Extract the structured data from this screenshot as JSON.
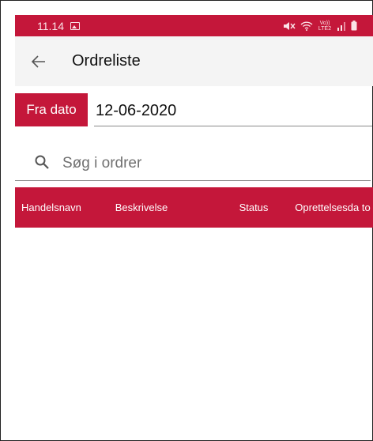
{
  "statusbar": {
    "time": "11.14",
    "icons": [
      "gallery-icon",
      "mute-icon",
      "wifi-icon",
      "volte-icon",
      "signal-icon",
      "battery-icon"
    ],
    "volte_text": "Vo)) LTE2"
  },
  "appbar": {
    "back_icon": "arrow-left-icon",
    "title": "Ordreliste"
  },
  "filter": {
    "from_date_label": "Fra dato",
    "from_date_value": "12-06-2020"
  },
  "search": {
    "icon": "search-icon",
    "placeholder": "Søg i ordrer",
    "value": ""
  },
  "table": {
    "columns": [
      "Handelsnavn",
      "Beskrivelse",
      "Status",
      "Oprettelsesda to"
    ],
    "rows": []
  },
  "colors": {
    "accent": "#c4173a",
    "appbar_bg": "#f4f4f4"
  }
}
